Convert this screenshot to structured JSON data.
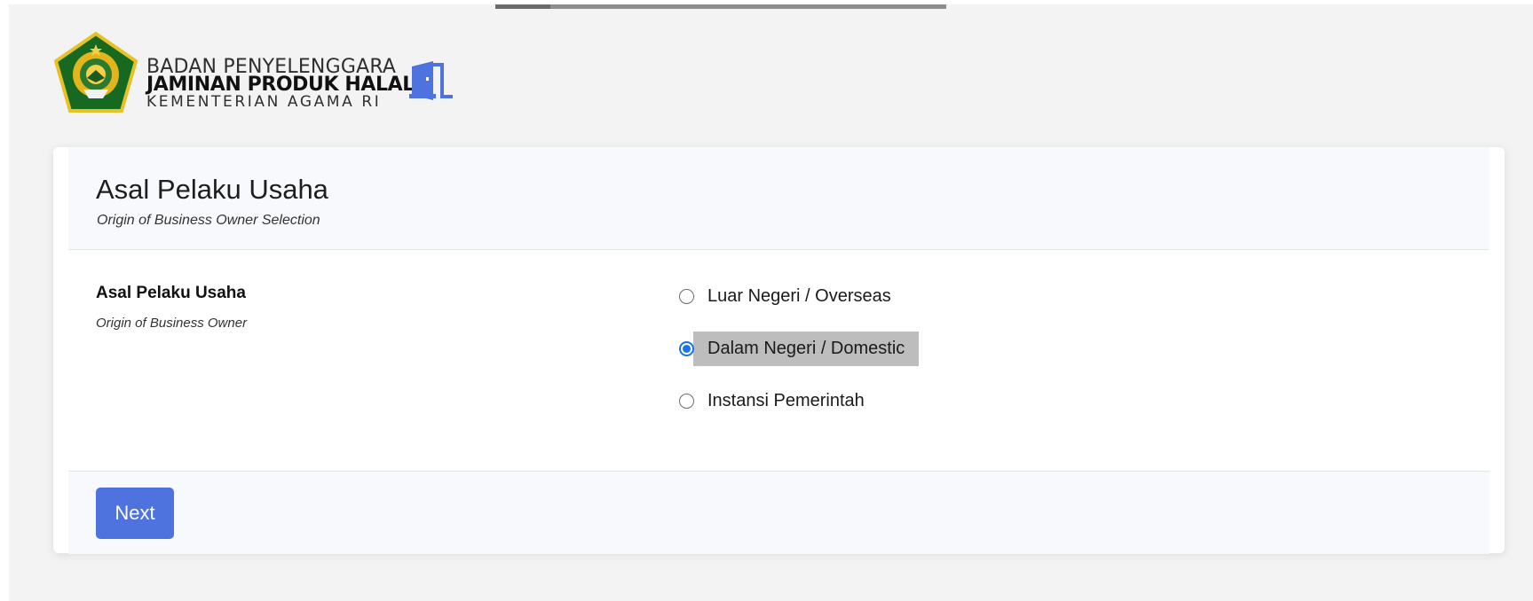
{
  "brand": {
    "line1": "BADAN PENYELENGGARA",
    "line2": "JAMINAN PRODUK HALAL",
    "line3": "KEMENTERIAN AGAMA RI",
    "logo_icon": "kemenag-emblem-icon",
    "logout_icon": "door-exit-icon",
    "accent_color": "#4e73df"
  },
  "card": {
    "title": "Asal Pelaku Usaha",
    "subtitle": "Origin of Business Owner Selection"
  },
  "field": {
    "label": "Asal Pelaku Usaha",
    "hint": "Origin of Business Owner",
    "options": [
      {
        "label": "Luar Negeri / Overseas",
        "checked": false
      },
      {
        "label": "Dalam Negeri / Domestic",
        "checked": true
      },
      {
        "label": "Instansi Pemerintah",
        "checked": false
      }
    ]
  },
  "footer": {
    "next_label": "Next"
  }
}
